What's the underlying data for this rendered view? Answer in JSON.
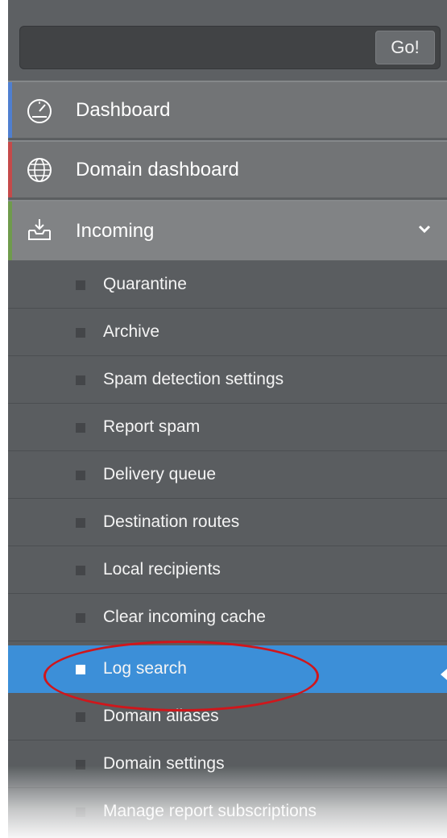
{
  "search": {
    "placeholder": "",
    "value": "",
    "go_label": "Go!"
  },
  "nav": {
    "dashboard": {
      "label": "Dashboard",
      "icon": "gauge-icon",
      "accent": "#4f7fd0"
    },
    "domain_dashboard": {
      "label": "Domain dashboard",
      "icon": "globe-icon",
      "accent": "#c54a4a"
    },
    "incoming": {
      "label": "Incoming",
      "icon": "inbox-download-icon",
      "accent": "#6f9b4c",
      "expanded": true
    }
  },
  "incoming_items": [
    {
      "label": "Quarantine",
      "selected": false
    },
    {
      "label": "Archive",
      "selected": false
    },
    {
      "label": "Spam detection settings",
      "selected": false
    },
    {
      "label": "Report spam",
      "selected": false
    },
    {
      "label": "Delivery queue",
      "selected": false
    },
    {
      "label": "Destination routes",
      "selected": false
    },
    {
      "label": "Local recipients",
      "selected": false
    },
    {
      "label": "Clear incoming cache",
      "selected": false
    },
    {
      "label": "Log search",
      "selected": true
    },
    {
      "label": "Domain aliases",
      "selected": false
    },
    {
      "label": "Domain settings",
      "selected": false
    },
    {
      "label": "Manage report subscriptions",
      "selected": false
    }
  ],
  "colors": {
    "selected": "#3c8fd8",
    "highlight_circle": "#d0161b"
  }
}
